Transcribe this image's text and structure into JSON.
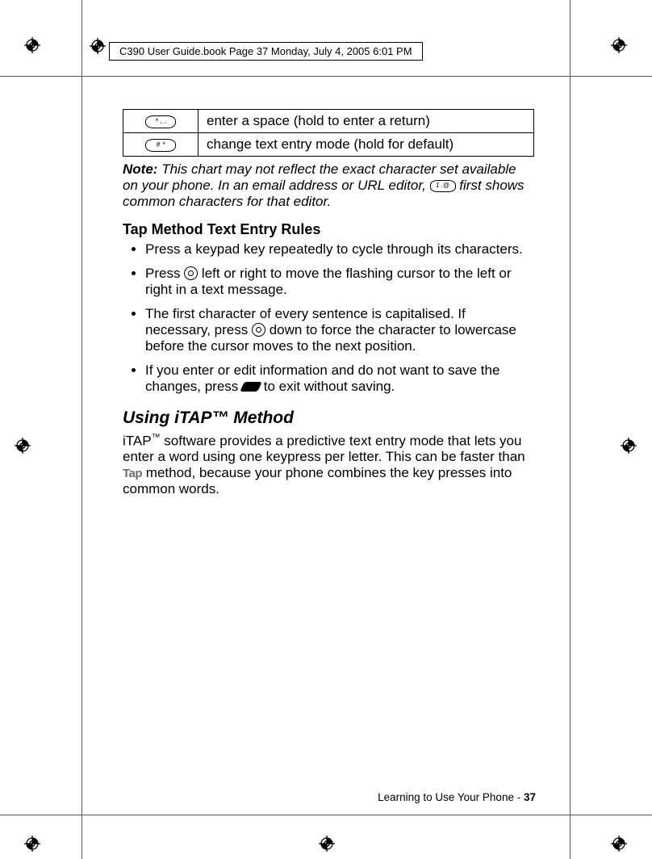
{
  "file_header": "C390 User Guide.book  Page 37  Monday, July 4, 2005  6:01 PM",
  "table": {
    "rows": [
      {
        "key_glyph": "* ⌴",
        "desc": "enter a space (hold to enter a return)"
      },
      {
        "key_glyph": "# *",
        "desc": "change text entry mode (hold for default)"
      }
    ]
  },
  "note": {
    "label": "Note:",
    "before_key": "This chart may not reflect the exact character set available on your phone. In an email address or URL editor, ",
    "key_glyph": "1 .@",
    "after_key": " first shows common characters for that editor."
  },
  "subheading": "Tap Method Text Entry Rules",
  "bullets": {
    "b1": "Press a keypad key repeatedly to cycle through its characters.",
    "b2_before": "Press ",
    "b2_after": " left or right to move the flashing cursor to the left or right in a text message.",
    "b3_before": "The first character of every sentence is capitalised. If necessary, press ",
    "b3_after": " down to force the character to lowercase before the cursor moves to the next position.",
    "b4_before": "If you enter or edit information and do not want to save the changes, press ",
    "b4_after": " to exit without saving."
  },
  "section_heading": "Using iTAP™ Method",
  "itap": {
    "p_before": "iTAP",
    "tm": "™",
    "p_mid": " software provides a predictive text entry mode that lets you enter a word using one keypress per letter. This can be faster than ",
    "tap_word": "Tap",
    "p_after": " method, because your phone combines the key presses into common words."
  },
  "footer": {
    "text": "Learning to Use Your Phone - ",
    "page": "37"
  }
}
